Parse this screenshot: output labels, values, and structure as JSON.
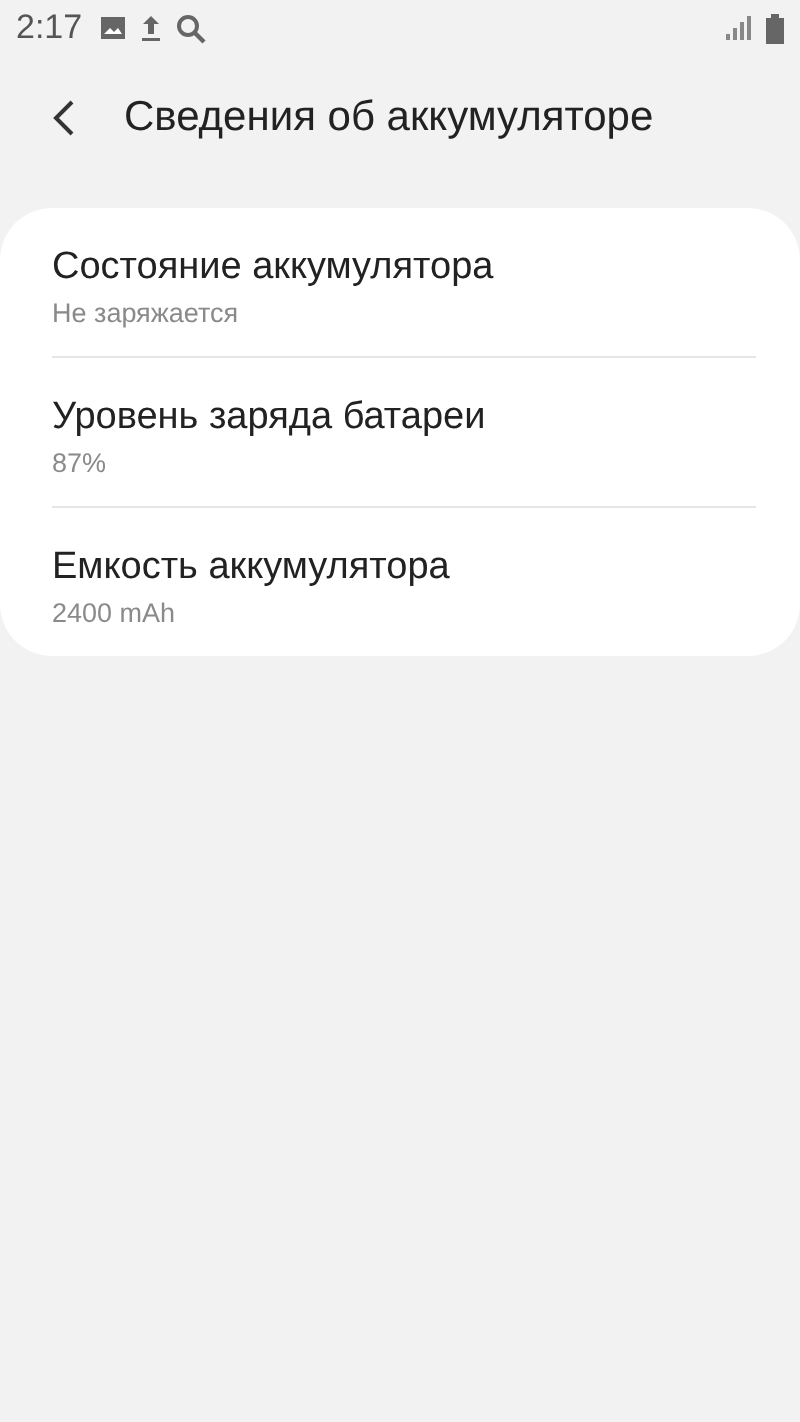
{
  "status_bar": {
    "time": "2:17"
  },
  "header": {
    "title": "Сведения об аккумуляторе"
  },
  "items": [
    {
      "title": "Состояние аккумулятора",
      "value": "Не заряжается"
    },
    {
      "title": "Уровень заряда батареи",
      "value": "87%"
    },
    {
      "title": "Емкость аккумулятора",
      "value": "2400 mAh"
    }
  ]
}
